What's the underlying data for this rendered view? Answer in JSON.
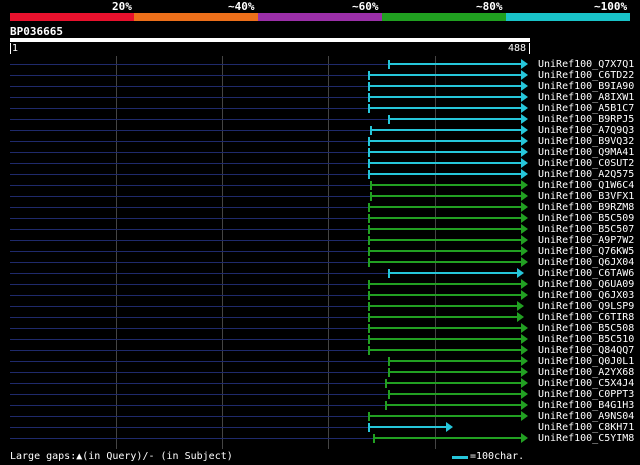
{
  "header": {
    "percent_labels": [
      "20%",
      "~40%",
      "~60%",
      "~80%",
      "~100%"
    ],
    "colors": [
      "#e8112d",
      "#ec6f1a",
      "#9b2fa8",
      "#20a020",
      "#19c3c8"
    ],
    "query_name": "BP036665",
    "ruler_start": "1",
    "ruler_end": "488"
  },
  "legend": {
    "gaps_text": "Large gaps:▲(in Query)/- (in Subject)",
    "scale_text": "=100char."
  },
  "chart_data": {
    "type": "bar",
    "query_length": 488,
    "hits": [
      {
        "id": "UniRef100_Q7X7Q1",
        "start": 356,
        "end": 488,
        "color": "cyan"
      },
      {
        "id": "UniRef100_C6TD22",
        "start": 337,
        "end": 488,
        "color": "cyan"
      },
      {
        "id": "UniRef100_B9IA90",
        "start": 337,
        "end": 488,
        "color": "cyan"
      },
      {
        "id": "UniRef100_A8IXW1",
        "start": 337,
        "end": 488,
        "color": "cyan"
      },
      {
        "id": "UniRef100_A5B1C7",
        "start": 337,
        "end": 488,
        "color": "cyan"
      },
      {
        "id": "UniRef100_B9RPJ5",
        "start": 356,
        "end": 488,
        "color": "cyan"
      },
      {
        "id": "UniRef100_A7Q9Q3",
        "start": 339,
        "end": 488,
        "color": "cyan"
      },
      {
        "id": "UniRef100_B9VQ32",
        "start": 337,
        "end": 488,
        "color": "cyan"
      },
      {
        "id": "UniRef100_Q9MA41",
        "start": 337,
        "end": 488,
        "color": "cyan"
      },
      {
        "id": "UniRef100_C0SUT2",
        "start": 337,
        "end": 488,
        "color": "cyan"
      },
      {
        "id": "UniRef100_A2Q575",
        "start": 337,
        "end": 488,
        "color": "cyan"
      },
      {
        "id": "UniRef100_Q1W6C4",
        "start": 339,
        "end": 488,
        "color": "green"
      },
      {
        "id": "UniRef100_B3VFX1",
        "start": 339,
        "end": 488,
        "color": "green"
      },
      {
        "id": "UniRef100_B9RZM8",
        "start": 337,
        "end": 488,
        "color": "green"
      },
      {
        "id": "UniRef100_B5C509",
        "start": 337,
        "end": 488,
        "color": "green"
      },
      {
        "id": "UniRef100_B5C507",
        "start": 337,
        "end": 488,
        "color": "green"
      },
      {
        "id": "UniRef100_A9P7W2",
        "start": 337,
        "end": 488,
        "color": "green"
      },
      {
        "id": "UniRef100_Q76KW5",
        "start": 337,
        "end": 488,
        "color": "green"
      },
      {
        "id": "UniRef100_Q6JX04",
        "start": 337,
        "end": 488,
        "color": "green"
      },
      {
        "id": "UniRef100_C6TAW6",
        "start": 356,
        "end": 484,
        "color": "cyan"
      },
      {
        "id": "UniRef100_Q6UA09",
        "start": 337,
        "end": 488,
        "color": "green"
      },
      {
        "id": "UniRef100_Q6JX03",
        "start": 337,
        "end": 488,
        "color": "green"
      },
      {
        "id": "UniRef100_Q9LSP9",
        "start": 337,
        "end": 484,
        "color": "green"
      },
      {
        "id": "UniRef100_C6TIR8",
        "start": 337,
        "end": 484,
        "color": "green"
      },
      {
        "id": "UniRef100_B5C508",
        "start": 337,
        "end": 488,
        "color": "green"
      },
      {
        "id": "UniRef100_B5C510",
        "start": 337,
        "end": 488,
        "color": "green"
      },
      {
        "id": "UniRef100_Q84QQ7",
        "start": 337,
        "end": 488,
        "color": "green"
      },
      {
        "id": "UniRef100_Q0J0L1",
        "start": 356,
        "end": 488,
        "color": "green"
      },
      {
        "id": "UniRef100_A2YX68",
        "start": 356,
        "end": 488,
        "color": "green"
      },
      {
        "id": "UniRef100_C5X4J4",
        "start": 353,
        "end": 488,
        "color": "green"
      },
      {
        "id": "UniRef100_C0PPT3",
        "start": 356,
        "end": 488,
        "color": "green"
      },
      {
        "id": "UniRef100_B4G1H3",
        "start": 353,
        "end": 488,
        "color": "green"
      },
      {
        "id": "UniRef100_A9NS04",
        "start": 337,
        "end": 488,
        "color": "green"
      },
      {
        "id": "UniRef100_C8KH71",
        "start": 337,
        "end": 417,
        "color": "cyan"
      },
      {
        "id": "UniRef100_C5YIM8",
        "start": 342,
        "end": 488,
        "color": "green"
      }
    ]
  }
}
